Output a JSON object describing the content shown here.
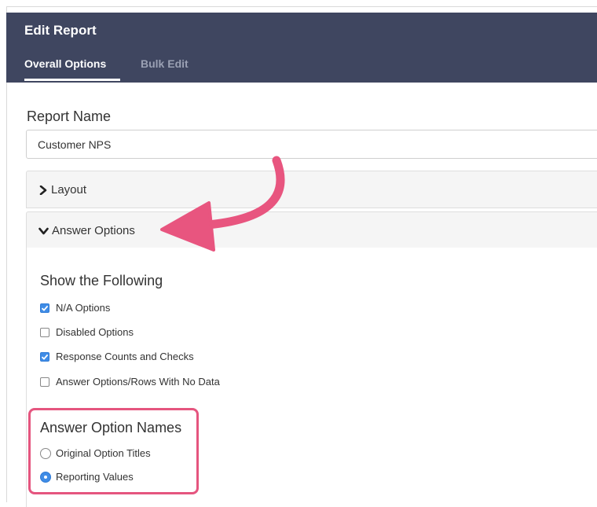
{
  "header": {
    "title": "Edit Report",
    "tabs": [
      {
        "label": "Overall Options",
        "active": true
      },
      {
        "label": "Bulk Edit",
        "active": false
      }
    ]
  },
  "report_name": {
    "label": "Report Name",
    "value": "Customer NPS"
  },
  "panels": {
    "layout": {
      "label": "Layout",
      "icon": "chevron-right-icon",
      "expanded": false
    },
    "answer_options": {
      "label": "Answer Options",
      "icon": "chevron-down-icon",
      "expanded": true
    }
  },
  "show_following": {
    "title": "Show the Following",
    "options": [
      {
        "label": "N/A Options",
        "checked": true
      },
      {
        "label": "Disabled Options",
        "checked": false
      },
      {
        "label": "Response Counts and Checks",
        "checked": true
      },
      {
        "label": "Answer Options/Rows With No Data",
        "checked": false
      }
    ]
  },
  "answer_option_names": {
    "title": "Answer Option Names",
    "options": [
      {
        "label": "Original Option Titles",
        "selected": false
      },
      {
        "label": "Reporting Values",
        "selected": true
      }
    ]
  },
  "colors": {
    "header_bg": "#3f4660",
    "accent": "#3f8ce6",
    "annotation": "#e8557f"
  }
}
